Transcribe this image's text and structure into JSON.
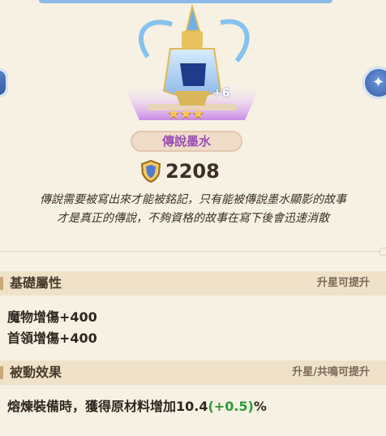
{
  "item": {
    "name": "傳說墨水",
    "enhance_label": "+6",
    "stars": "★★★",
    "power_value": "2208",
    "description_line1": "傳說需要被寫出來才能被銘記，只有能被傳說墨水顯影的故事",
    "description_line2": "才是真正的傳說，不夠資格的故事在寫下後會迅速消散"
  },
  "sections": {
    "base": {
      "title": "基礎屬性",
      "hint": "升星可提升",
      "lines": [
        "魔物增傷+400",
        "首領增傷+400"
      ]
    },
    "passive": {
      "title": "被動效果",
      "hint": "升星/共鳴可提升",
      "line_prefix": "熔煉裝備時，獲得原材料增加10.4",
      "line_bonus": "(+0.5)",
      "line_suffix": "%"
    }
  },
  "colors": {
    "name_text": "#9b4fb4",
    "bonus_green": "#2e9b3a",
    "section_bg": "#efe2c8",
    "page_bg": "#f7f1e3"
  },
  "icons": [
    "chevron-left-icon",
    "sparkle-icon",
    "ink-bottle-icon",
    "star-icon",
    "shield-power-icon"
  ]
}
